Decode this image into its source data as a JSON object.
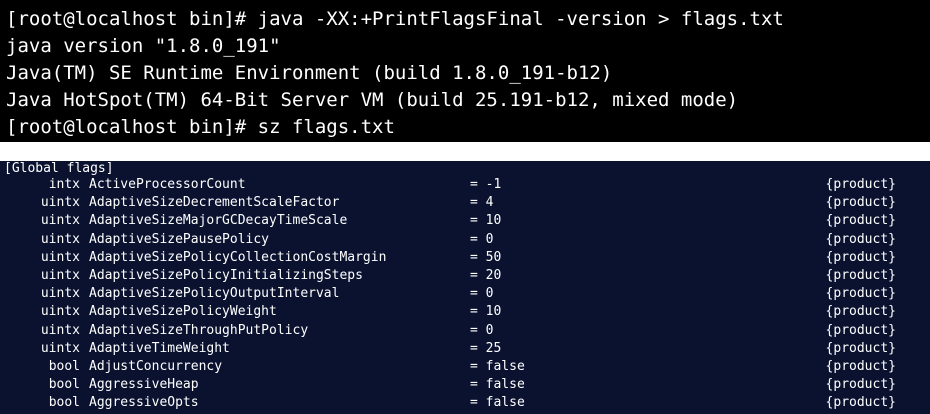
{
  "terminal_top": {
    "lines": [
      "[root@localhost bin]# java -XX:+PrintFlagsFinal -version > flags.txt",
      "java version \"1.8.0_191\"",
      "Java(TM) SE Runtime Environment (build 1.8.0_191-b12)",
      "Java HotSpot(TM) 64-Bit Server VM (build 25.191-b12, mixed mode)",
      "[root@localhost bin]# sz flags.txt"
    ]
  },
  "flags_file": {
    "header": "[Global flags]",
    "rows": [
      {
        "type": "intx",
        "name": "ActiveProcessorCount",
        "value": "= -1",
        "kind": "{product}"
      },
      {
        "type": "uintx",
        "name": "AdaptiveSizeDecrementScaleFactor",
        "value": "= 4",
        "kind": "{product}"
      },
      {
        "type": "uintx",
        "name": "AdaptiveSizeMajorGCDecayTimeScale",
        "value": "= 10",
        "kind": "{product}"
      },
      {
        "type": "uintx",
        "name": "AdaptiveSizePausePolicy",
        "value": "= 0",
        "kind": "{product}"
      },
      {
        "type": "uintx",
        "name": "AdaptiveSizePolicyCollectionCostMargin",
        "value": "= 50",
        "kind": "{product}"
      },
      {
        "type": "uintx",
        "name": "AdaptiveSizePolicyInitializingSteps",
        "value": "= 20",
        "kind": "{product}"
      },
      {
        "type": "uintx",
        "name": "AdaptiveSizePolicyOutputInterval",
        "value": "= 0",
        "kind": "{product}"
      },
      {
        "type": "uintx",
        "name": "AdaptiveSizePolicyWeight",
        "value": "= 10",
        "kind": "{product}"
      },
      {
        "type": "uintx",
        "name": "AdaptiveSizeThroughPutPolicy",
        "value": "= 0",
        "kind": "{product}"
      },
      {
        "type": "uintx",
        "name": "AdaptiveTimeWeight",
        "value": "= 25",
        "kind": "{product}"
      },
      {
        "type": "bool",
        "name": "AdjustConcurrency",
        "value": "= false",
        "kind": "{product}"
      },
      {
        "type": "bool",
        "name": "AggressiveHeap",
        "value": "= false",
        "kind": "{product}"
      },
      {
        "type": "bool",
        "name": "AggressiveOpts",
        "value": "= false",
        "kind": "{product}"
      }
    ]
  }
}
